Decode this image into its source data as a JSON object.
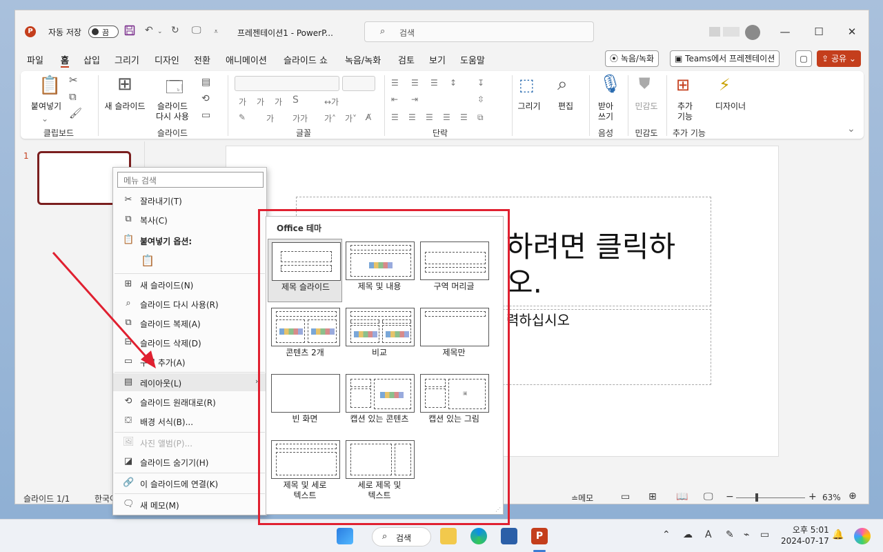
{
  "app": {
    "title": "프레젠테이션1  -  PowerP...",
    "autosave_label": "자동 저장",
    "autosave_state": "끔",
    "search_placeholder": "검색"
  },
  "menu_tabs": [
    "파일",
    "홈",
    "삽입",
    "그리기",
    "디자인",
    "전환",
    "애니메이션",
    "슬라이드 쇼",
    "녹음/녹화",
    "검토",
    "보기",
    "도움말"
  ],
  "active_tab": "홈",
  "right_buttons": {
    "record": "녹음/녹화",
    "teams": "Teams에서 프레젠테이션",
    "share": "공유"
  },
  "ribbon": {
    "paste": "붙여넣기",
    "new_slide": "새 슬라이드",
    "reuse_slide_1": "슬라이드",
    "reuse_slide_2": "다시 사용",
    "draw": "그리기",
    "edit": "편집",
    "dictate_1": "받아",
    "dictate_2": "쓰기",
    "sensitivity": "민감도",
    "addins_1": "추가",
    "addins_2": "기능",
    "designer": "디자이너",
    "groups": {
      "clipboard": "클립보드",
      "slides": "슬라이드",
      "font": "글꼴",
      "paragraph": "단락",
      "voice": "음성",
      "sensitivity": "민감도",
      "addins": "추가 기능"
    }
  },
  "slides": {
    "thumb_number": "1"
  },
  "slide": {
    "title_line1": "하려면 클릭하",
    "title_line2": "오.",
    "subtitle": "력하십시오"
  },
  "status": {
    "slide_count": "슬라이드 1/1",
    "language": "한국어",
    "notes": "메모",
    "zoom": "63%"
  },
  "context_menu": {
    "search_placeholder": "메뉴 검색",
    "items": {
      "cut": "잘라내기(T)",
      "copy": "복사(C)",
      "paste_options": "붙여넣기 옵션:",
      "new_slide": "새 슬라이드(N)",
      "reuse_slide": "슬라이드 다시 사용(R)",
      "duplicate": "슬라이드 복제(A)",
      "delete": "슬라이드 삭제(D)",
      "add_section": "구역 추가(A)",
      "layout": "레이아웃(L)",
      "reset": "슬라이드 원래대로(R)",
      "format_bg": "배경 서식(B)...",
      "photo_album": "사진 앨범(P)...",
      "hide": "슬라이드 숨기기(H)",
      "link": "이 슬라이드에 연결(K)",
      "new_comment": "새 메모(M)"
    }
  },
  "layout_gallery": {
    "header": "Office 테마",
    "layouts": {
      "title_slide": "제목 슬라이드",
      "title_content": "제목 및 내용",
      "section_header": "구역 머리글",
      "two_content_1": "콘텐츠 2개",
      "comparison": "비교",
      "title_only": "제목만",
      "blank": "빈 화면",
      "content_caption": "캡션 있는 콘텐츠",
      "picture_caption": "캡션 있는 그림",
      "vert_title_text_1": "제목 및 세로",
      "vert_title_text_2": "텍스트",
      "vert_both_1": "세로 제목 및",
      "vert_both_2": "텍스트"
    }
  },
  "taskbar": {
    "search": "검색",
    "time": "오후 5:01",
    "date": "2024-07-17"
  },
  "colors": {
    "accent": "#c43e1c",
    "highlight_box": "#e02030",
    "thumb_border": "#7a1e1e"
  }
}
